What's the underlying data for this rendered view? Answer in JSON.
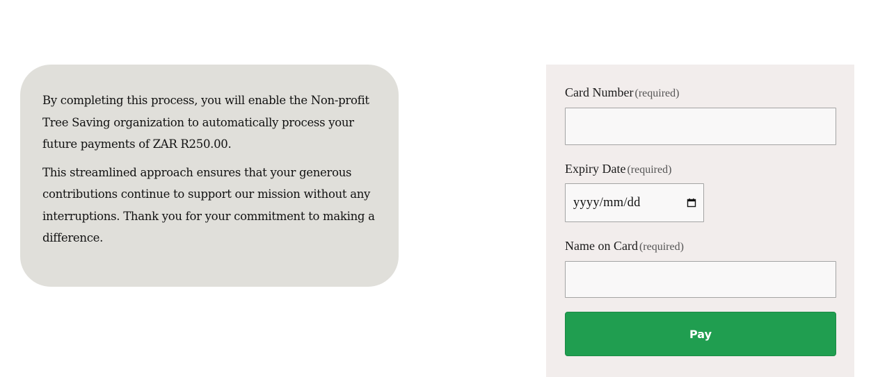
{
  "info": {
    "paragraph_1": "By completing this process, you will enable the Non-profit Tree Saving organization to automatically process your future payments of ZAR R250.00.",
    "paragraph_2": "This streamlined approach ensures that your generous contributions continue to support our mission without any interruptions. Thank you for your commitment to making a difference."
  },
  "form": {
    "card_number": {
      "label": "Card Number",
      "required_text": "(required)",
      "value": "",
      "placeholder": ""
    },
    "expiry_date": {
      "label": "Expiry Date",
      "required_text": "(required)",
      "placeholder": "yyyy/mm/dd",
      "icon": "calendar-icon"
    },
    "name_on_card": {
      "label": "Name on Card",
      "required_text": "(required)",
      "value": "",
      "placeholder": ""
    },
    "pay_button_label": "Pay"
  },
  "colors": {
    "info_card_bg": "#e0dfda",
    "panel_bg": "#f2edec",
    "pay_button_bg": "#209e50"
  }
}
